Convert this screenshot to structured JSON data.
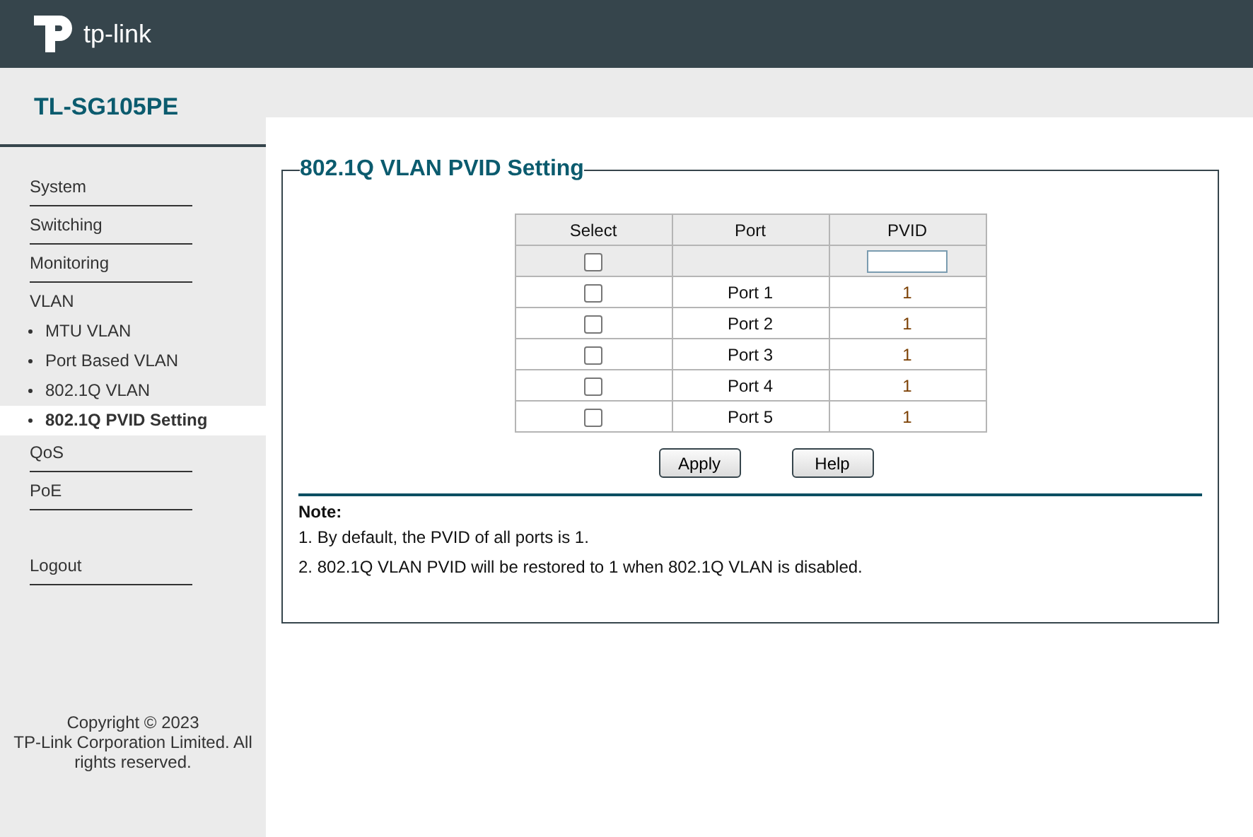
{
  "header": {
    "logo_text": "tp-link"
  },
  "model": "TL-SG105PE",
  "sidebar": {
    "items": [
      {
        "label": "System",
        "kind": "section",
        "selected": false
      },
      {
        "label": "Switching",
        "kind": "section",
        "selected": false
      },
      {
        "label": "Monitoring",
        "kind": "section",
        "selected": false
      },
      {
        "label": "VLAN",
        "kind": "group",
        "selected": false
      },
      {
        "label": "MTU VLAN",
        "kind": "sub",
        "selected": false
      },
      {
        "label": "Port Based VLAN",
        "kind": "sub",
        "selected": false
      },
      {
        "label": "802.1Q VLAN",
        "kind": "sub",
        "selected": false
      },
      {
        "label": "802.1Q PVID Setting",
        "kind": "sub",
        "selected": true
      },
      {
        "label": "QoS",
        "kind": "section",
        "selected": false
      },
      {
        "label": "PoE",
        "kind": "section",
        "selected": false
      },
      {
        "label": "Logout",
        "kind": "logout",
        "selected": false
      }
    ],
    "copyright": [
      "Copyright © 2023",
      "TP-Link Corporation Limited. All rights reserved."
    ]
  },
  "panel": {
    "title": "802.1Q VLAN PVID Setting",
    "table": {
      "columns": [
        "Select",
        "Port",
        "PVID"
      ],
      "select_all": {
        "checked": false
      },
      "rows": [
        {
          "checked": false,
          "port": "Port 1",
          "pvid": "1"
        },
        {
          "checked": false,
          "port": "Port 2",
          "pvid": "1"
        },
        {
          "checked": false,
          "port": "Port 3",
          "pvid": "1"
        },
        {
          "checked": false,
          "port": "Port 4",
          "pvid": "1"
        },
        {
          "checked": false,
          "port": "Port 5",
          "pvid": "1"
        }
      ]
    },
    "buttons": [
      "Apply",
      "Help"
    ],
    "note": {
      "title": "Note:",
      "lines": [
        "1. By default, the PVID of all ports is 1.",
        "2. 802.1Q VLAN PVID will be restored to 1 when 802.1Q VLAN is disabled."
      ]
    }
  }
}
